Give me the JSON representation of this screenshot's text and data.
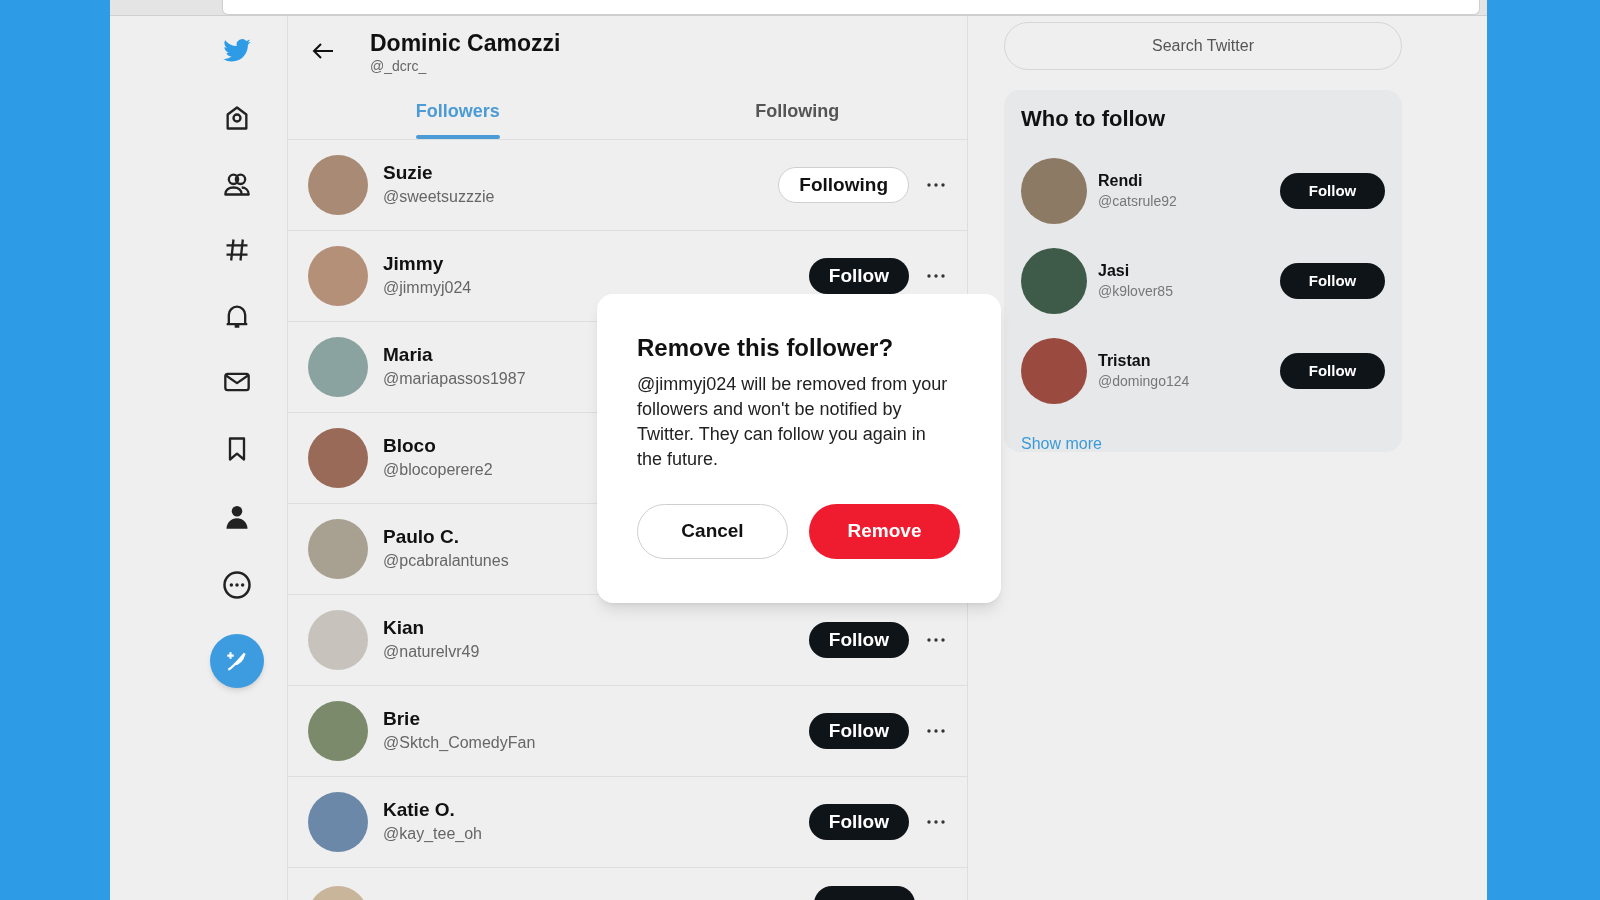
{
  "profile": {
    "name": "Dominic Camozzi",
    "handle": "@_dcrc_"
  },
  "tabs": [
    {
      "label": "Followers",
      "selected": true
    },
    {
      "label": "Following",
      "selected": false
    }
  ],
  "followers": [
    {
      "name": "Suzie",
      "handle": "@sweetsuzzzie",
      "button": {
        "label": "Following",
        "kind": "following"
      }
    },
    {
      "name": "Jimmy",
      "handle": "@jimmyj024",
      "button": {
        "label": "Follow",
        "kind": "follow"
      }
    },
    {
      "name": "Maria",
      "handle": "@mariapassos1987"
    },
    {
      "name": "Bloco",
      "handle": "@blocoperere2"
    },
    {
      "name": "Paulo C.",
      "handle": "@pcabralantunes"
    },
    {
      "name": "Kian",
      "handle": "@naturelvr49",
      "button": {
        "label": "Follow",
        "kind": "follow"
      }
    },
    {
      "name": "Brie",
      "handle": "@Sktch_ComedyFan",
      "button": {
        "label": "Follow",
        "kind": "follow"
      }
    },
    {
      "name": "Katie O.",
      "handle": "@kay_tee_oh",
      "button": {
        "label": "Follow",
        "kind": "follow"
      }
    }
  ],
  "search": {
    "placeholder": "Search Twitter"
  },
  "who_to_follow": {
    "title": "Who to follow",
    "users": [
      {
        "name": "Rendi",
        "handle": "@catsrule92",
        "button": "Follow"
      },
      {
        "name": "Jasi",
        "handle": "@k9lover85",
        "button": "Follow"
      },
      {
        "name": "Tristan",
        "handle": "@domingo124",
        "button": "Follow"
      }
    ],
    "show_more": "Show more"
  },
  "dialog": {
    "title": "Remove this follower?",
    "body": "@jimmyj024 will be removed from your followers and won't be notified by Twitter. They can follow you again in the future.",
    "cancel": "Cancel",
    "confirm": "Remove"
  }
}
